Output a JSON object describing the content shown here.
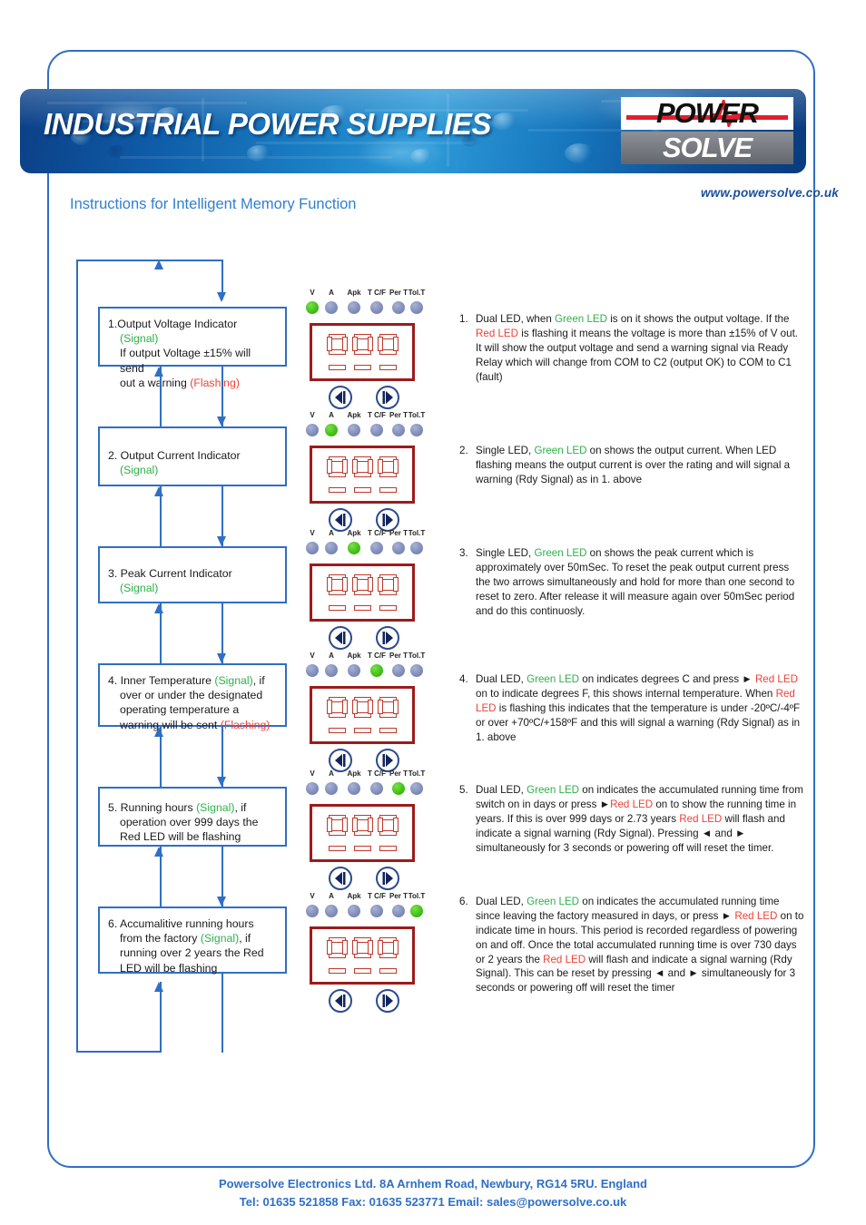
{
  "header": {
    "title": "INDUSTRIAL POWER SUPPLIES",
    "logo_top": "POWER",
    "logo_bottom": "SOLVE",
    "website": "www.powersolve.co.uk",
    "subtitle": "Instructions for Intelligent Memory Function",
    "accent_blue": "#2f6fc4",
    "logo_red": "#e0202a"
  },
  "flow_boxes": [
    {
      "line1_pre": "1.Output Voltage Indicator ",
      "line1_signal": "(Signal)",
      "line2": "If output Voltage ±15% will send",
      "line3_pre": "out a warning ",
      "line3_flash": "(Flashing)"
    },
    {
      "line1_pre": "2. Output Current Indicator",
      "line1_signal": "",
      "line2": "",
      "line3_pre": "",
      "line3_flash": "",
      "signal_only": "(Signal)"
    },
    {
      "line1_pre": "3. Peak Current Indicator",
      "line1_signal": "",
      "line2": "",
      "line3_pre": "",
      "line3_flash": "",
      "signal_only": "(Signal)"
    },
    {
      "line1_pre": "4. Inner Temperature ",
      "line1_signal": "(Signal)",
      "line1_post": ", if",
      "line2": "over or under the designated",
      "line3": "operating temperature a",
      "line4_pre": "warning will be sent ",
      "line4_flash": "(Flashing)"
    },
    {
      "line1_pre": "5. Running hours ",
      "line1_signal": "(Signal)",
      "line1_post": ", if",
      "line2": "operation over 999 days the",
      "line3": "Red LED will be flashing"
    },
    {
      "line1_pre": "6. Accumalitive running hours",
      "line2_pre": "from the factory ",
      "line2_signal": "(Signal)",
      "line2_post": ", if",
      "line3": "running over 2 years the Red",
      "line4": "LED will be flashing"
    }
  ],
  "panel_labels": [
    "V",
    "A",
    "Apk",
    "T C/F",
    "Per T",
    "Tol.T"
  ],
  "panels": [
    {
      "active_index": 0,
      "digits": "888"
    },
    {
      "active_index": 1,
      "digits": "888"
    },
    {
      "active_index": 2,
      "digits": "888"
    },
    {
      "active_index": 3,
      "digits": "888"
    },
    {
      "active_index": 4,
      "digits": "888"
    },
    {
      "active_index": 5,
      "digits": "888"
    }
  ],
  "led_colors": {
    "off": "#7f8cb8",
    "on": "#43c018",
    "display_red": "#c0392b"
  },
  "notes": [
    {
      "num": "1.",
      "segments": [
        {
          "t": "Dual LED, when ",
          "c": "black"
        },
        {
          "t": "Green LED",
          "c": "green"
        },
        {
          "t": " is on it shows the output voltage. If the ",
          "c": "black"
        },
        {
          "t": "Red LED",
          "c": "red"
        },
        {
          "t": " is flashing it means the voltage is more than ±15% of V out. It will show the output voltage and send a warning signal via Ready Relay which will change from COM to C2 (output OK) to COM to C1 (fault)",
          "c": "black"
        }
      ]
    },
    {
      "num": "2.",
      "segments": [
        {
          "t": "Single LED, ",
          "c": "black"
        },
        {
          "t": "Green LED",
          "c": "green"
        },
        {
          "t": " on shows the output current. When LED flashing means the output current is over the rating and will signal a warning (Rdy Signal) as in 1. above",
          "c": "black"
        }
      ]
    },
    {
      "num": "3.",
      "segments": [
        {
          "t": "Single LED, ",
          "c": "black"
        },
        {
          "t": "Green LED",
          "c": "green"
        },
        {
          "t": " on shows the peak current which is approximately over 50mSec. To reset the peak output current press the two arrows simultaneously and hold for more than one second to reset to zero. After release it will measure again over 50mSec period and do this continuosly.",
          "c": "black"
        }
      ]
    },
    {
      "num": "4.",
      "segments": [
        {
          "t": "Dual LED, ",
          "c": "black"
        },
        {
          "t": "Green LED",
          "c": "green"
        },
        {
          "t": " on indicates degrees C and press ► ",
          "c": "black"
        },
        {
          "t": "Red LED",
          "c": "red"
        },
        {
          "t": " on to indicate degrees F, this shows internal temperature.  When ",
          "c": "black"
        },
        {
          "t": "Red LED",
          "c": "red"
        },
        {
          "t": " is flashing this indicates that the temperature is under -20ºC/-4ºF or over +70ºC/+158ºF and this will signal a warning (Rdy Signal) as in 1. above",
          "c": "black"
        }
      ]
    },
    {
      "num": "5.",
      "segments": [
        {
          "t": "Dual LED, ",
          "c": "black"
        },
        {
          "t": "Green LED",
          "c": "green"
        },
        {
          "t": " on indicates the accumulated running time from switch on in days or press ►",
          "c": "black"
        },
        {
          "t": "Red LED",
          "c": "red"
        },
        {
          "t": " on to show the running time in years. If this is over 999 days or 2.73 years ",
          "c": "black"
        },
        {
          "t": "Red LED",
          "c": "red"
        },
        {
          "t": " will flash and indicate a signal warning (Rdy Signal). Pressing ◄ and ► simultaneously for 3 seconds or powering off will reset the timer.",
          "c": "black"
        }
      ]
    },
    {
      "num": "6.",
      "segments": [
        {
          "t": "Dual LED, ",
          "c": "black"
        },
        {
          "t": "Green LED",
          "c": "green"
        },
        {
          "t": " on indicates the accumulated running time since leaving the factory measured in days, or press ► ",
          "c": "black"
        },
        {
          "t": "Red LED",
          "c": "red"
        },
        {
          "t": " on to indicate time in hours. This period is recorded regardless of powering on and off. Once the total accumulated running time is over 730 days or 2 years the ",
          "c": "black"
        },
        {
          "t": "Red LED",
          "c": "red"
        },
        {
          "t": " will flash and indicate a signal warning (Rdy Signal). This can be reset by pressing ◄ and ► simultaneously for 3 seconds or powering off will reset the timer",
          "c": "black"
        }
      ]
    }
  ],
  "footer": {
    "line1": "Powersolve Electronics Ltd.  8A Arnhem Road,  Newbury, RG14 5RU.  England",
    "line2": "Tel: 01635 521858  Fax: 01635 523771  Email: sales@powersolve.co.uk"
  }
}
